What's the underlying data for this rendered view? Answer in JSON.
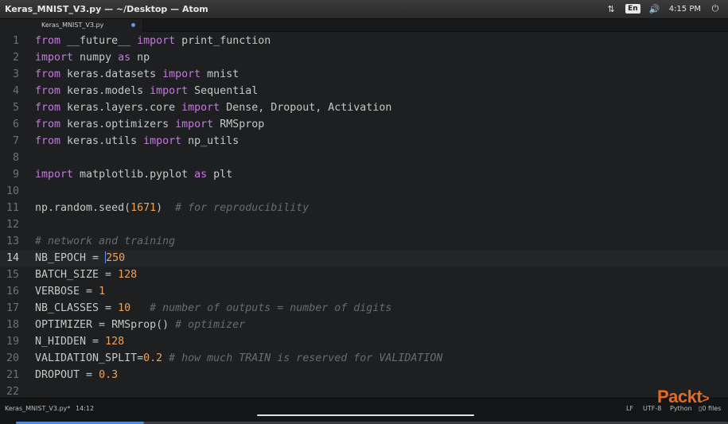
{
  "window": {
    "title": "Keras_MNIST_V3.py — ~/Desktop — Atom"
  },
  "tray": {
    "lang": "En",
    "time": "4:15 PM"
  },
  "tab": {
    "label": "Keras_MNIST_V3.py",
    "modified": true
  },
  "colors": {
    "keyword": "#c678dd",
    "number": "#f0a25a",
    "comment": "#676c72",
    "text": "#c5c8c6",
    "accent": "#4b8ad6",
    "logo": "#e36b24"
  },
  "editor": {
    "active_line": 14,
    "lines": [
      {
        "n": "1",
        "segs": [
          [
            "kw",
            "from"
          ],
          [
            "t",
            " __future__ "
          ],
          [
            "kw",
            "import"
          ],
          [
            "t",
            " print_function"
          ]
        ]
      },
      {
        "n": "2",
        "segs": [
          [
            "kw",
            "import"
          ],
          [
            "t",
            " numpy "
          ],
          [
            "kw",
            "as"
          ],
          [
            "t",
            " np"
          ]
        ]
      },
      {
        "n": "3",
        "segs": [
          [
            "kw",
            "from"
          ],
          [
            "t",
            " keras.datasets "
          ],
          [
            "kw",
            "import"
          ],
          [
            "t",
            " mnist"
          ]
        ]
      },
      {
        "n": "4",
        "segs": [
          [
            "kw",
            "from"
          ],
          [
            "t",
            " keras.models "
          ],
          [
            "kw",
            "import"
          ],
          [
            "t",
            " Sequential"
          ]
        ]
      },
      {
        "n": "5",
        "segs": [
          [
            "kw",
            "from"
          ],
          [
            "t",
            " keras.layers.core "
          ],
          [
            "kw",
            "import"
          ],
          [
            "t",
            " Dense, Dropout, Activation"
          ]
        ]
      },
      {
        "n": "6",
        "segs": [
          [
            "kw",
            "from"
          ],
          [
            "t",
            " keras.optimizers "
          ],
          [
            "kw",
            "import"
          ],
          [
            "t",
            " RMSprop"
          ]
        ]
      },
      {
        "n": "7",
        "segs": [
          [
            "kw",
            "from"
          ],
          [
            "t",
            " keras.utils "
          ],
          [
            "kw",
            "import"
          ],
          [
            "t",
            " np_utils"
          ]
        ]
      },
      {
        "n": "8",
        "segs": []
      },
      {
        "n": "9",
        "segs": [
          [
            "kw",
            "import"
          ],
          [
            "t",
            " matplotlib.pyplot "
          ],
          [
            "kw",
            "as"
          ],
          [
            "t",
            " plt"
          ]
        ]
      },
      {
        "n": "10",
        "segs": []
      },
      {
        "n": "11",
        "segs": [
          [
            "t",
            "np.random.seed("
          ],
          [
            "num",
            "1671"
          ],
          [
            "t",
            ")  "
          ],
          [
            "com",
            "# for reproducibility"
          ]
        ]
      },
      {
        "n": "12",
        "segs": []
      },
      {
        "n": "13",
        "segs": [
          [
            "com",
            "# network and training"
          ]
        ]
      },
      {
        "n": "14",
        "segs": [
          [
            "t",
            "NB_EPOCH = "
          ],
          [
            "caret",
            ""
          ],
          [
            "num",
            "250"
          ]
        ]
      },
      {
        "n": "15",
        "segs": [
          [
            "t",
            "BATCH_SIZE = "
          ],
          [
            "num",
            "128"
          ]
        ]
      },
      {
        "n": "16",
        "segs": [
          [
            "t",
            "VERBOSE = "
          ],
          [
            "num",
            "1"
          ]
        ]
      },
      {
        "n": "17",
        "segs": [
          [
            "t",
            "NB_CLASSES = "
          ],
          [
            "num",
            "10"
          ],
          [
            "t",
            "   "
          ],
          [
            "com",
            "# number of outputs = number of digits"
          ]
        ]
      },
      {
        "n": "18",
        "segs": [
          [
            "t",
            "OPTIMIZER = RMSprop() "
          ],
          [
            "com",
            "# optimizer"
          ]
        ]
      },
      {
        "n": "19",
        "segs": [
          [
            "t",
            "N_HIDDEN = "
          ],
          [
            "num",
            "128"
          ]
        ]
      },
      {
        "n": "20",
        "segs": [
          [
            "t",
            "VALIDATION_SPLIT="
          ],
          [
            "num",
            "0.2"
          ],
          [
            "t",
            " "
          ],
          [
            "com",
            "# how much TRAIN is reserved for VALIDATION"
          ]
        ]
      },
      {
        "n": "21",
        "segs": [
          [
            "t",
            "DROPOUT = "
          ],
          [
            "num",
            "0.3"
          ]
        ]
      },
      {
        "n": "22",
        "segs": []
      }
    ]
  },
  "statusbar": {
    "file": "Keras_MNIST_V3.py*",
    "cursor": "14:12",
    "line_ending": "LF",
    "encoding": "UTF-8",
    "grammar": "Python",
    "files": "0 files"
  },
  "video": {
    "progress": 0.18
  },
  "logo": {
    "text": "Packt",
    "mark": ">"
  }
}
